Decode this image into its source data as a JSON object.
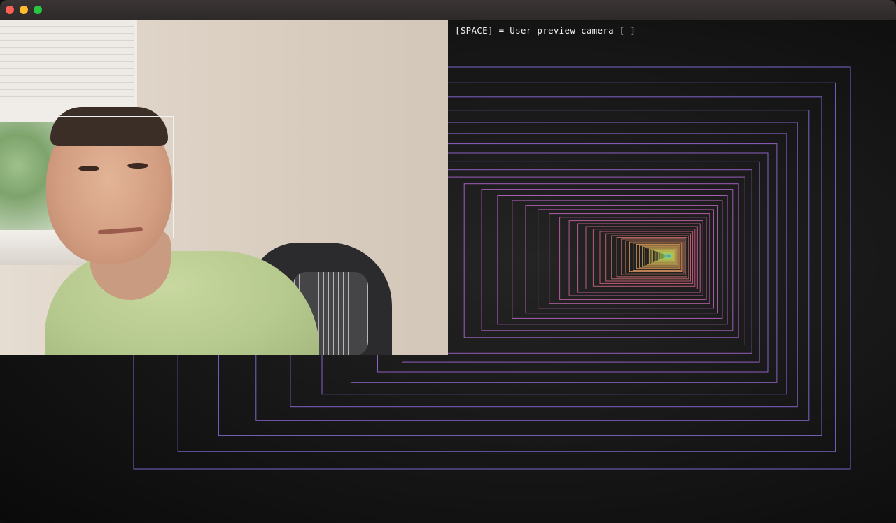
{
  "window": {
    "traffic_lights": {
      "close_color": "#fe5f57",
      "minimize_color": "#febc2e",
      "maximize_color": "#28c840"
    }
  },
  "hud": {
    "hint_text": "[SPACE] = User preview camera [ ]"
  },
  "camera_preview": {
    "face_detection_box_color": "#f2f2f2"
  },
  "tunnel": {
    "colors": [
      "#7b6bd4",
      "#9a64cf",
      "#c266c4",
      "#d9647f",
      "#e0a05a",
      "#d7c75a",
      "#a8d05a",
      "#5fcf9a",
      "#5fb0d8",
      "#7b6bd4"
    ],
    "background": "#141414"
  }
}
